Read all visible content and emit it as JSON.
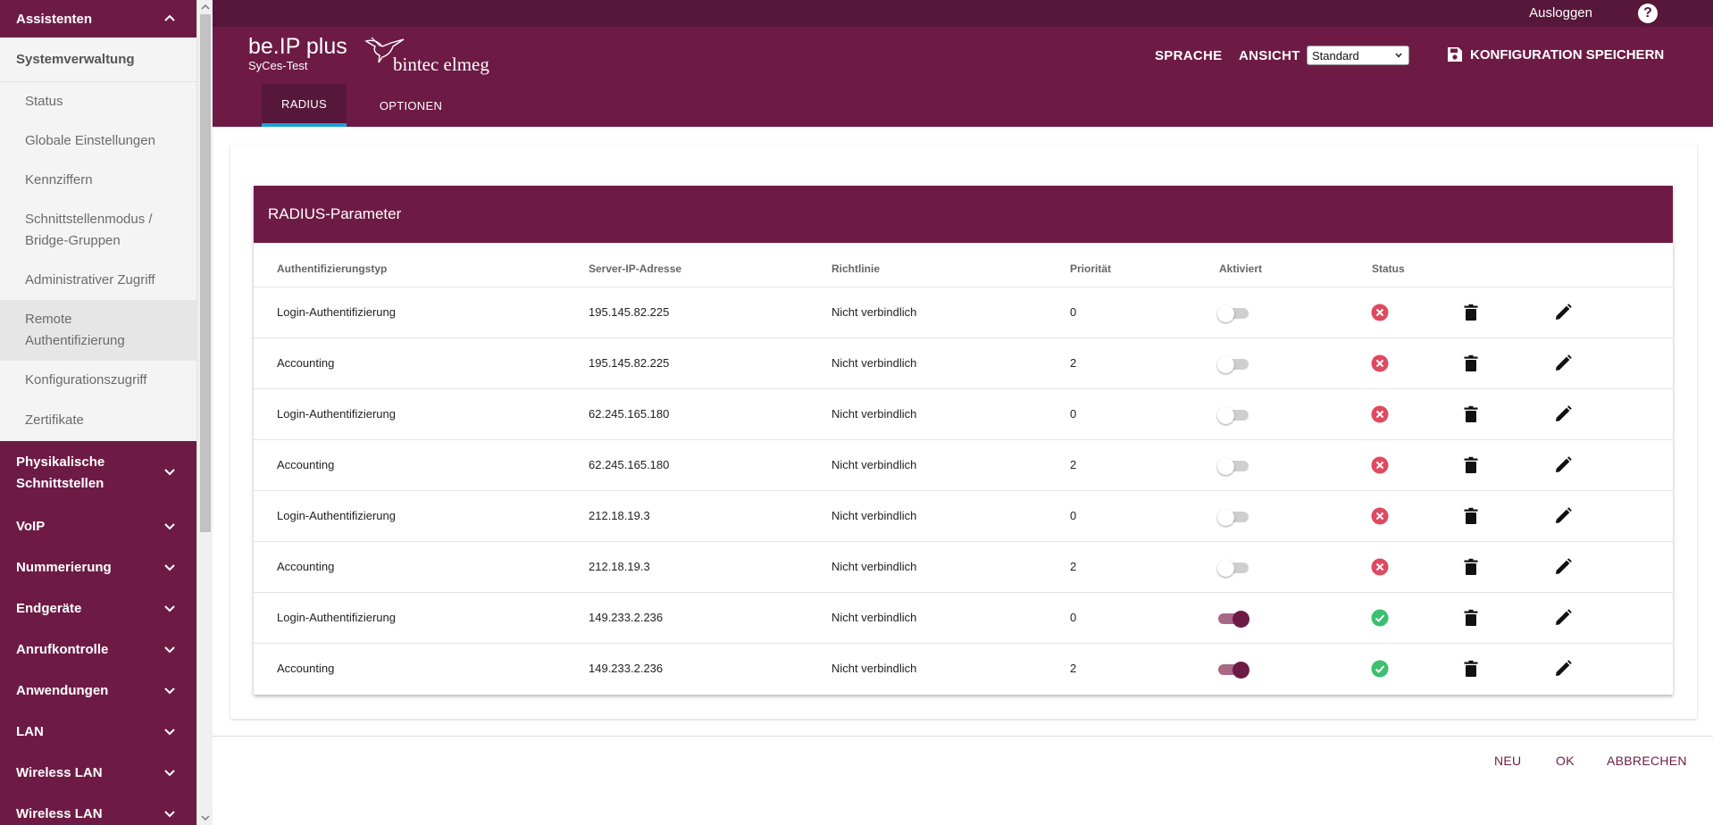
{
  "sidebar": {
    "top_group": "Assistenten",
    "open_group": "Systemverwaltung",
    "items": [
      {
        "label": "Status",
        "active": false
      },
      {
        "label": "Globale Einstellungen",
        "active": false
      },
      {
        "label": "Kennziffern",
        "active": false
      },
      {
        "label": "Schnittstellenmodus / Bridge-Gruppen",
        "active": false
      },
      {
        "label": "Administrativer Zugriff",
        "active": false
      },
      {
        "label": "Remote Authentifizierung",
        "active": true
      },
      {
        "label": "Konfigurationszugriff",
        "active": false
      },
      {
        "label": "Zertifikate",
        "active": false
      }
    ],
    "groups": [
      "Physikalische Schnittstellen",
      "VoIP",
      "Nummerierung",
      "Endgeräte",
      "Anrufkontrolle",
      "Anwendungen",
      "LAN",
      "Wireless LAN",
      "Wireless LAN"
    ]
  },
  "header": {
    "product": "be.IP plus",
    "device_name": "SyCes-Test",
    "logo_text": "bintec elmeg",
    "logout": "Ausloggen",
    "help": "?",
    "language": "SPRACHE",
    "view_label": "ANSICHT",
    "view_value": "Standard",
    "save": "KONFIGURATION SPEICHERN",
    "tabs": [
      "RADIUS",
      "OPTIONEN"
    ]
  },
  "card": {
    "title": "RADIUS-Parameter",
    "columns": [
      "Authentifizierungstyp",
      "Server-IP-Adresse",
      "Richtlinie",
      "Priorität",
      "Aktiviert",
      "Status"
    ],
    "rows": [
      {
        "type": "Login-Authentifizierung",
        "ip": "195.145.82.225",
        "policy": "Nicht verbindlich",
        "priority": "0",
        "enabled": false,
        "status": "error"
      },
      {
        "type": "Accounting",
        "ip": "195.145.82.225",
        "policy": "Nicht verbindlich",
        "priority": "2",
        "enabled": false,
        "status": "error"
      },
      {
        "type": "Login-Authentifizierung",
        "ip": "62.245.165.180",
        "policy": "Nicht verbindlich",
        "priority": "0",
        "enabled": false,
        "status": "error"
      },
      {
        "type": "Accounting",
        "ip": "62.245.165.180",
        "policy": "Nicht verbindlich",
        "priority": "2",
        "enabled": false,
        "status": "error"
      },
      {
        "type": "Login-Authentifizierung",
        "ip": "212.18.19.3",
        "policy": "Nicht verbindlich",
        "priority": "0",
        "enabled": false,
        "status": "error"
      },
      {
        "type": "Accounting",
        "ip": "212.18.19.3",
        "policy": "Nicht verbindlich",
        "priority": "2",
        "enabled": false,
        "status": "error"
      },
      {
        "type": "Login-Authentifizierung",
        "ip": "149.233.2.236",
        "policy": "Nicht verbindlich",
        "priority": "0",
        "enabled": true,
        "status": "ok"
      },
      {
        "type": "Accounting",
        "ip": "149.233.2.236",
        "policy": "Nicht verbindlich",
        "priority": "2",
        "enabled": true,
        "status": "ok"
      }
    ]
  },
  "footer": {
    "new": "NEU",
    "ok": "OK",
    "cancel": "ABBRECHEN"
  },
  "colors": {
    "brand": "#6d1b45",
    "brand_dark": "#56173a",
    "tab_indicator": "#1aa3d8",
    "status_error": "#e04a60",
    "status_ok": "#3cbf6e"
  }
}
